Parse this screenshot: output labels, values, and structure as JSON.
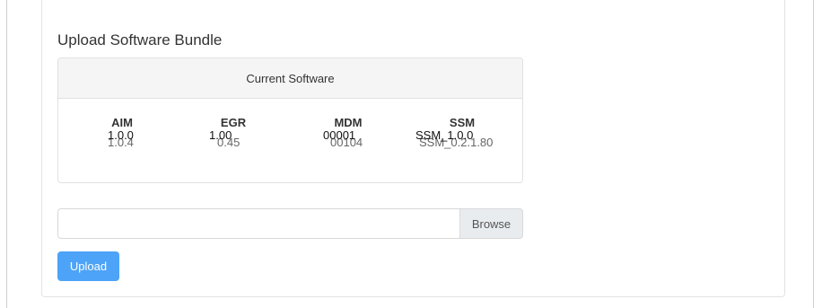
{
  "section": {
    "title": "Upload Software Bundle"
  },
  "current_software": {
    "header": "Current Software",
    "items": [
      {
        "name": "AIM",
        "version": "1.0.0",
        "version_behind": "1.0.4"
      },
      {
        "name": "EGR",
        "version": "1.00",
        "version_behind": "0.45"
      },
      {
        "name": "MDM",
        "version": "00001",
        "version_behind": "00104"
      },
      {
        "name": "SSM",
        "version": "SSM_1.0.0",
        "version_behind": "SSM_0.2.1.80"
      }
    ]
  },
  "upload": {
    "file_value": "",
    "browse_label": "Browse",
    "upload_label": "Upload"
  },
  "colors": {
    "primary": "#4da3f7",
    "panel_header_bg": "#f5f5f5",
    "browse_bg": "#e9ecef"
  }
}
